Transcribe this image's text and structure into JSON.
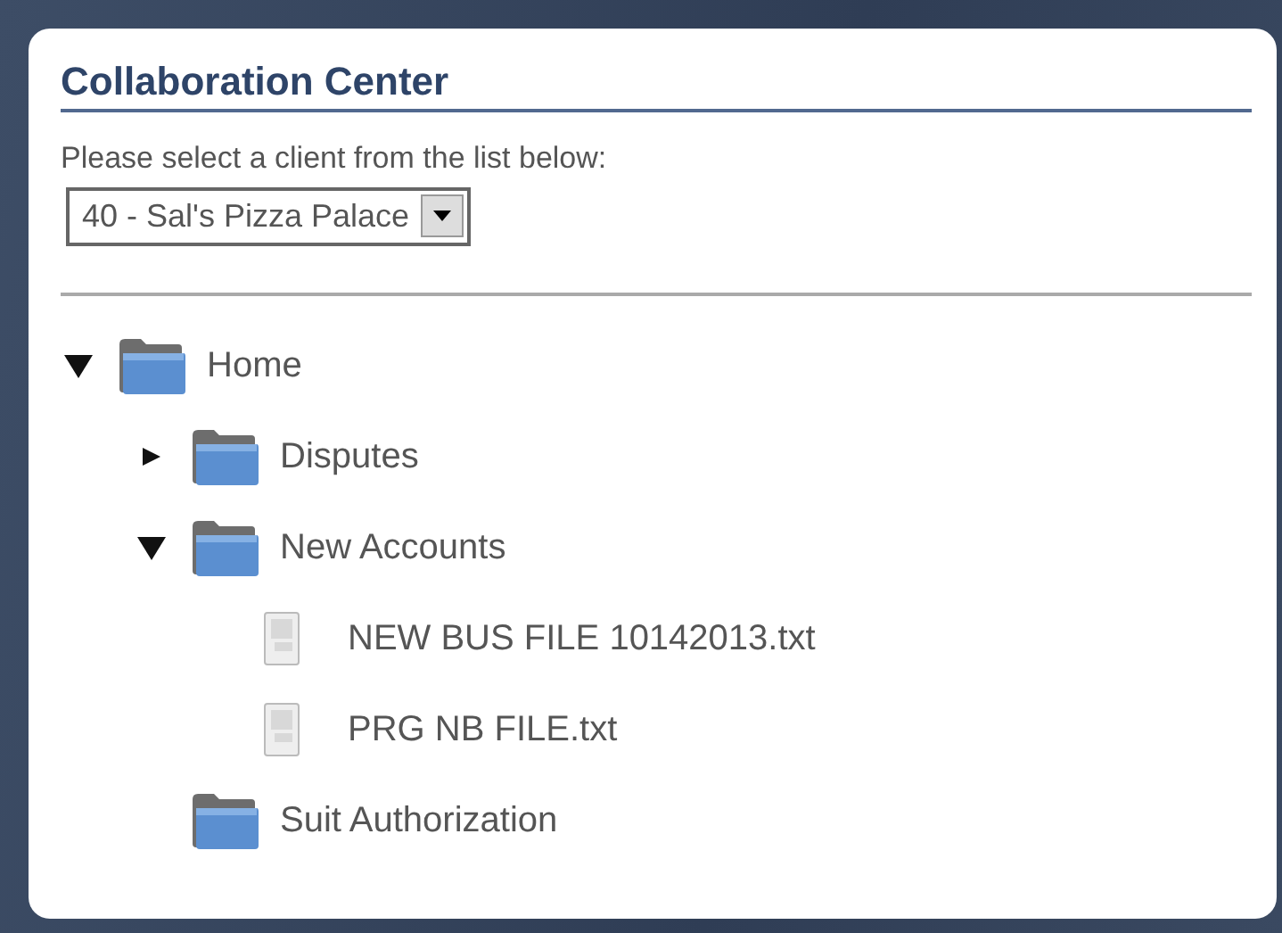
{
  "panel": {
    "title": "Collaboration Center"
  },
  "client_select": {
    "label": "Please select a client from the list below:",
    "value": "40 - Sal's Pizza Palace"
  },
  "tree": [
    {
      "kind": "folder",
      "label": "Home",
      "expanded": true,
      "children": [
        {
          "kind": "folder",
          "label": "Disputes",
          "expanded": false
        },
        {
          "kind": "folder",
          "label": "New Accounts",
          "expanded": true,
          "children": [
            {
              "kind": "file",
              "label": "NEW BUS FILE 10142013.txt"
            },
            {
              "kind": "file",
              "label": "PRG NB FILE.txt"
            }
          ]
        },
        {
          "kind": "folder",
          "label": "Suit Authorization"
        }
      ]
    }
  ]
}
